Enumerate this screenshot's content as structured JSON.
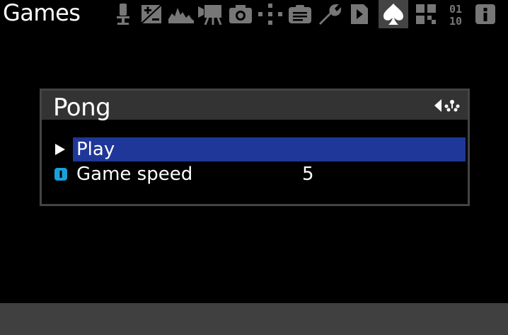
{
  "topbar": {
    "title": "Games",
    "tabs": [
      {
        "icon": "microphone-icon"
      },
      {
        "icon": "exposure-icon"
      },
      {
        "icon": "histogram-icon"
      },
      {
        "icon": "movie-camera-icon"
      },
      {
        "icon": "camera-icon"
      },
      {
        "icon": "focus-points-icon"
      },
      {
        "icon": "clipboard-icon"
      },
      {
        "icon": "wrench-icon"
      },
      {
        "icon": "play-file-icon"
      },
      {
        "icon": "spade-icon",
        "active": true
      },
      {
        "icon": "modules-icon"
      },
      {
        "icon": "binary-icon"
      },
      {
        "icon": "info-icon"
      }
    ]
  },
  "panel": {
    "title": "Pong",
    "items": [
      {
        "label": "Play",
        "value": "",
        "icon": "play-arrow-icon",
        "selected": true
      },
      {
        "label": "Game speed",
        "value": "5",
        "icon": "slider-toggle-icon",
        "selected": false
      }
    ]
  },
  "colors": {
    "background": "#000000",
    "active_tab": "#444444",
    "selection": "#1f3799",
    "bottom_bar": "#404040",
    "toggle_icon": "#1aa0d8"
  }
}
